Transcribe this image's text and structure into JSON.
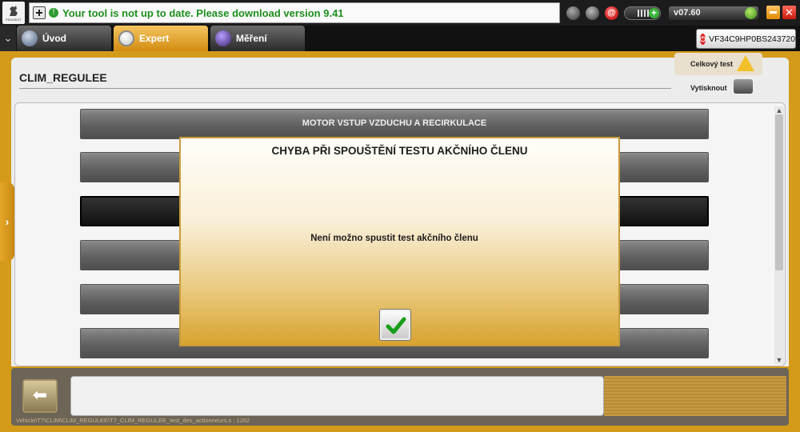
{
  "topbar": {
    "logo_text": "PEUGEOT",
    "notice": "Your tool is not up to date. Please download version 9.41",
    "version": "v07.60"
  },
  "tabs": [
    {
      "label": "Úvod",
      "icon": "globe-icon",
      "selected": false
    },
    {
      "label": "Expert",
      "icon": "magnifier-icon",
      "selected": true
    },
    {
      "label": "Měření",
      "icon": "waveform-icon",
      "selected": false
    }
  ],
  "vin": "VF34C9HP0BS243720",
  "page": {
    "title": "CLIM_REGULEE"
  },
  "side_actions": {
    "test_label": "Celkový test",
    "print_label": "Vytisknout"
  },
  "list": {
    "items": [
      {
        "label": "MOTOR VSTUP VZDUCHU A RECIRKULACE"
      },
      {
        "label": ""
      },
      {
        "label": ""
      },
      {
        "label": ""
      },
      {
        "label": ""
      },
      {
        "label": ""
      }
    ],
    "selected_index": 2
  },
  "dialog": {
    "title": "CHYBA PŘI SPOUŠTĚNÍ TESTU AKČNÍHO ČLENU",
    "message": "Není možno spustit test akčního členu",
    "ok_icon": "checkmark-icon"
  },
  "status_bar": {
    "path": "Vehicle\\T7\\CLIM\\CLIM_REGULEE\\T7_CLIM_REGULEE_test_des_actionneurs.s : 1262"
  },
  "colors": {
    "accent": "#d49a1a",
    "notice_text": "#1e8f1e",
    "dialog_border": "#c79c3c"
  }
}
